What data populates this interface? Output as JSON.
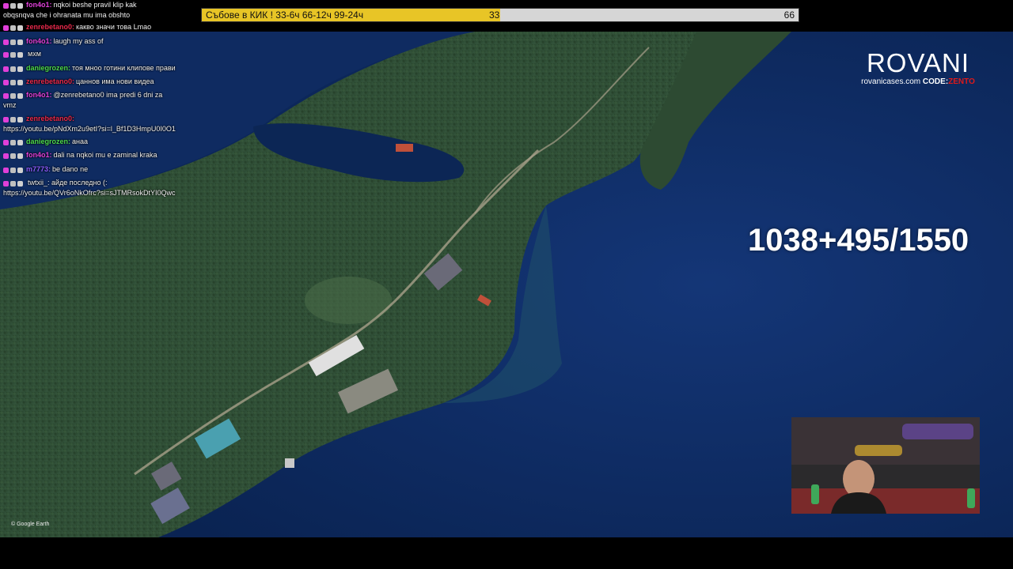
{
  "progress_bar": {
    "label": "Събове в КИК ! 33-6ч 66-12ч 99-24ч",
    "current_value": "33",
    "max_label": "66",
    "fill_fraction": 0.5
  },
  "chat": {
    "messages": [
      {
        "user": "fon4o1",
        "user_color": "#e03fd8",
        "text": "nqkoi beshe pravil klip kak",
        "text2": "obqsnqva che i ohranata mu ima obshto"
      },
      {
        "user": "zenrebetano0",
        "user_color": "#e8284a",
        "text": "какво значи това Lmao"
      },
      {
        "user": "fon4o1",
        "user_color": "#e03fd8",
        "text": "laugh my ass of"
      },
      {
        "user": "",
        "user_color": "#2c8a2c",
        "text": "мхм"
      },
      {
        "user": "daniegrozen",
        "user_color": "#4cd94c",
        "text": "тоя мноо готини клипове прави"
      },
      {
        "user": "zenrebetano0",
        "user_color": "#e8284a",
        "text": "цаннов има нови видеа"
      },
      {
        "user": "fon4o1",
        "user_color": "#e03fd8",
        "text": "@zenrebetano0 ima predi 6 dni za",
        "text2": "vmz"
      },
      {
        "user": "zenrebetano0",
        "user_color": "#e8284a",
        "text": "",
        "text2": "https://youtu.be/pNdXm2u9etI?si=l_Bf1D3HmpU0I0O1"
      },
      {
        "user": "daniegrozen",
        "user_color": "#4cd94c",
        "text": "анаа"
      },
      {
        "user": "fon4o1",
        "user_color": "#e03fd8",
        "text": "dali na nqkoi mu e zaminal kraka"
      },
      {
        "user": "m7773",
        "user_color": "#8a5cff",
        "text": "be dano ne"
      },
      {
        "user": "",
        "user_color": "#e8284a",
        "text": "twtxii_: айде последно (:",
        "text2": "https://youtu.be/QVr6oNkOfrc?si=sJTMRsokDtYI0Qwc"
      }
    ]
  },
  "brand": {
    "title": "ROVANI",
    "site": "rovanicases.com",
    "code_label": "CODE:",
    "code_value": "ZENTO"
  },
  "counter": "1038+495/1550",
  "attribution": "© Google Earth",
  "colors": {
    "water": "#0d2a5e",
    "forest": "#2e4a2e",
    "progress_fill": "#e8c526",
    "progress_track": "#d6d6d6",
    "brand_code": "#e01919"
  }
}
